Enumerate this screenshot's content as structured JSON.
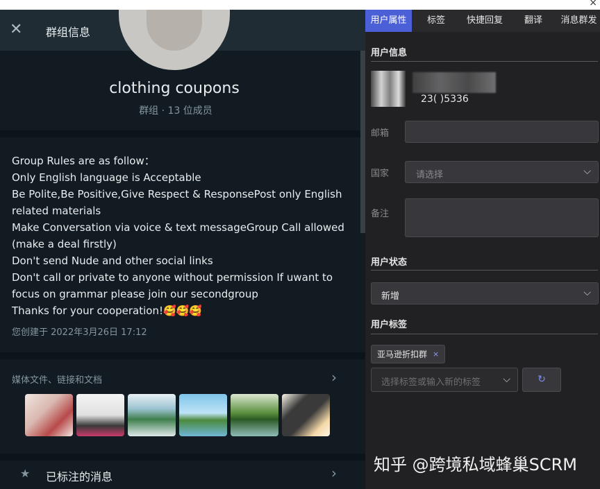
{
  "window": {
    "close_glyph": "×"
  },
  "left": {
    "header": {
      "close_glyph": "✕",
      "title": "群组信息"
    },
    "profile": {
      "name": "clothing coupons",
      "meta": "群组 · 13 位成员"
    },
    "description": {
      "lines": [
        "Group Rules are as follow：",
        "Only English language is Acceptable",
        "Be Polite,Be Positive,Give Respect & ResponsePost only English",
        "related materials",
        "Make Conversation via voice & text messageGroup Call allowed",
        "(make a deal firstly)",
        "Don't send Nude and other social links",
        "Don't call or private to anyone without permission If uwant to",
        "focus on grammar please join our secondgroup",
        "Thanks for your cooperation!"
      ],
      "emoji": "🥰🥰🥰",
      "created": "您创建于 2022年3月26日 17:12"
    },
    "media": {
      "title": "媒体文件、链接和文档",
      "chevron": "›"
    },
    "starred": {
      "star_glyph": "★",
      "label": "已标注的消息",
      "chevron": "›"
    }
  },
  "right": {
    "tabs": [
      {
        "label": "用户属性",
        "active": true
      },
      {
        "label": "标签"
      },
      {
        "label": "快捷回复"
      },
      {
        "label": "翻译"
      },
      {
        "label": "消息群发"
      }
    ],
    "user_info": {
      "title": "用户信息",
      "phone": "23(            )5336"
    },
    "email": {
      "label": "邮箱",
      "value": ""
    },
    "country": {
      "label": "国家",
      "placeholder": "请选择"
    },
    "note": {
      "label": "备注",
      "value": ""
    },
    "status": {
      "title": "用户状态",
      "value": "新增"
    },
    "tags": {
      "title": "用户标签",
      "chip": "亚马逊折扣群",
      "chip_remove": "×",
      "placeholder": "选择标签或输入新的标签",
      "refresh_glyph": "↻"
    },
    "watermark": "知乎 @跨境私域蜂巢SCRM"
  },
  "icons": {
    "close": "close-icon",
    "star": "star-icon",
    "chevron_right": "chevron-right-icon",
    "chevron_down": "chevron-down-icon",
    "refresh": "refresh-icon"
  },
  "colors": {
    "accent_tab": "#4b5fd6",
    "left_bg": "#111b21",
    "right_bg": "#212124"
  }
}
